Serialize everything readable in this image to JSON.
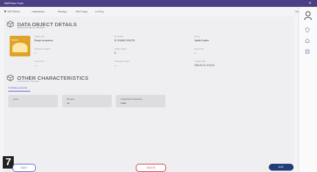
{
  "window": {
    "title": "NMRView Tools",
    "close_glyph": "✕"
  },
  "breadcrumbs": [
    "NDP 8000 ▸",
    "Laboratory ▸",
    "Racing ▸",
    "Mar-3 Ing ▸",
    "Lot 03 g"
  ],
  "breadcrumb_right": "Back",
  "sidebar_icons": [
    "user-icon",
    "shield-icon",
    "home-icon",
    "list-icon"
  ],
  "details": {
    "title": "DATA OBJECT DETAILS",
    "subtitle": "Detailed information on data object",
    "thumbnail_label": "Bread",
    "fields": [
      {
        "label": "Object type",
        "value": "Recipe component"
      },
      {
        "label": "ID number",
        "value": "ID 1234567-0001791"
      },
      {
        "label": "Name",
        "value": "Vanilla Powder"
      },
      {
        "label": "Reference weight",
        "value": "—"
      },
      {
        "label": "Target weight",
        "value": "8"
      },
      {
        "label": "Upper limit",
        "value": "—"
      },
      {
        "label": "Lower limit",
        "value": "—"
      },
      {
        "label": "Complete weight",
        "value": "—"
      },
      {
        "label": "Created date",
        "value": "2020-01-01 12:01:01"
      }
    ]
  },
  "characteristics": {
    "title": "OTHER CHARACTERISTICS",
    "subtitle": "Characteristics of the object",
    "tab_label": "FORMULATION",
    "boxes": [
      {
        "line1": "gross",
        "line2": ""
      },
      {
        "line1": "Remote",
        "line2": "off"
      },
      {
        "line1": "Analytical Temperature",
        "line2": "0.000"
      }
    ]
  },
  "badge": "7",
  "buttons": {
    "back": "BACK",
    "delete": "DELETE",
    "edit": "EDIT"
  }
}
